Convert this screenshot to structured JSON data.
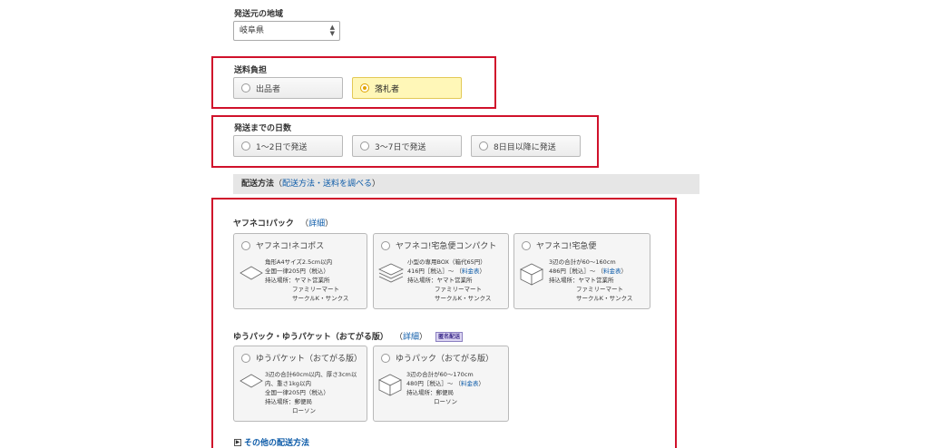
{
  "origin": {
    "label": "発送元の地域",
    "value": "岐阜県"
  },
  "shipping_burden": {
    "label": "送料負担",
    "options": [
      "出品者",
      "落札者"
    ],
    "selected": "落札者"
  },
  "days_to_ship": {
    "label": "発送までの日数",
    "options": [
      "1〜2日で発送",
      "3〜7日で発送",
      "8日目以降に発送"
    ]
  },
  "delivery": {
    "label": "配送方法",
    "paren_open": "（",
    "link": "配送方法・送料を調べる",
    "paren_close": "）"
  },
  "yafuneko": {
    "title": "ヤフネコ!パック",
    "detail_link": "詳細",
    "cards": [
      {
        "name": "ヤフネコ!ネコポス",
        "lines": [
          "角形A4サイズ2.5cm以内",
          "全国一律205円（税込）",
          "持込場所：ヤマト営業所",
          "ファミリーマート",
          "サークルK・サンクス"
        ]
      },
      {
        "name": "ヤフネコ!宅急便コンパクト",
        "lines": [
          "小型の専用BOX（箱代65円）",
          "416円［税込］〜",
          "料金表",
          "持込場所：ヤマト営業所",
          "ファミリーマート",
          "サークルK・サンクス"
        ]
      },
      {
        "name": "ヤフネコ!宅急便",
        "lines": [
          "3辺の合計が60〜160cm",
          "486円［税込］〜",
          "料金表",
          "持込場所：ヤマト営業所",
          "ファミリーマート",
          "サークルK・サンクス"
        ]
      }
    ]
  },
  "yupack": {
    "title": "ゆうパック・ゆうパケット（おてがる版）",
    "detail_link": "詳細",
    "badge": "匿名配送",
    "cards": [
      {
        "name": "ゆうパケット（おてがる版）",
        "lines": [
          "3辺の合計60cm以内、厚さ3cm以",
          "内、重さ1kg以内",
          "全国一律205円（税込）",
          "持込場所：郵便局",
          "ローソン"
        ]
      },
      {
        "name": "ゆうパック（おてがる版）",
        "lines": [
          "3辺の合計が60〜170cm",
          "480円［税込］〜",
          "料金表",
          "持込場所：郵便局",
          "ローソン"
        ]
      }
    ]
  },
  "other": {
    "label": "その他の配送方法"
  },
  "colors": {
    "highlight_red": "#d0112b",
    "link_blue": "#0b5aa8",
    "selected_yellow": "#fff7b8"
  }
}
